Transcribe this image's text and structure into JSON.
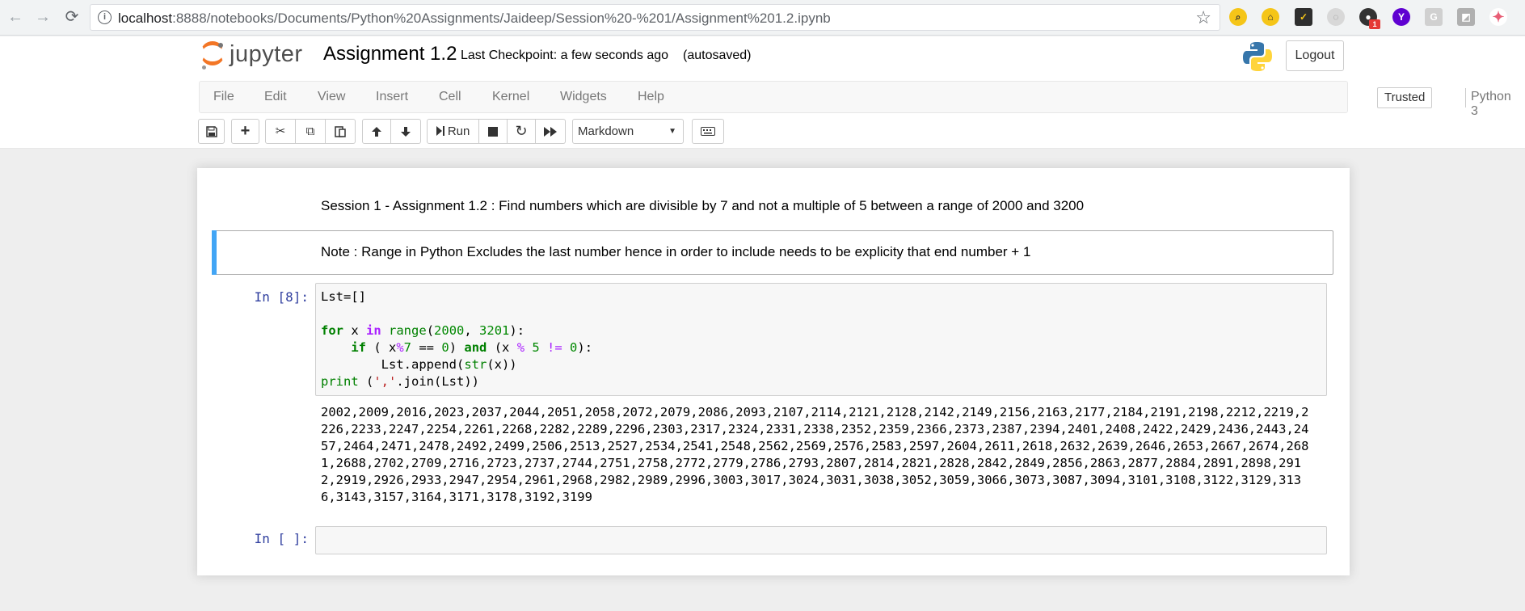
{
  "browser": {
    "url_host": "localhost",
    "url_rest": ":8888/notebooks/Documents/Python%20Assignments/Jaideep/Session%20-%201/Assignment%201.2.ipynb",
    "back_icon": "←",
    "forward_icon": "→",
    "reload_icon": "⟳",
    "info_icon": "i",
    "star_icon": "☆",
    "extensions": [
      {
        "icon": "search-extension-icon",
        "glyph": "⌕",
        "color": "#f5c518"
      },
      {
        "icon": "home-extension-icon",
        "glyph": "⌂",
        "color": "#f5c518"
      },
      {
        "icon": "checkmark-extension-icon",
        "glyph": "✓",
        "color": "#2e2e2e"
      },
      {
        "icon": "grey-circle-extension-icon",
        "glyph": "◌",
        "color": "#b0b0b0"
      },
      {
        "icon": "game-extension-icon",
        "glyph": "●",
        "color": "#333333",
        "badge": "1"
      },
      {
        "icon": "yahoo-extension-icon",
        "glyph": "Y",
        "color": "#5f01d1"
      },
      {
        "icon": "grey-g-extension-icon",
        "glyph": "G",
        "color": "#c0c0c0"
      },
      {
        "icon": "square-extension-icon",
        "glyph": "◩",
        "color": "#a0a0a0"
      },
      {
        "icon": "pinwheel-extension-icon",
        "glyph": "✦",
        "color": "#e85d75"
      }
    ]
  },
  "header": {
    "logo_text": "jupyter",
    "notebook_title": "Assignment 1.2",
    "checkpoint": "Last Checkpoint: a few seconds ago",
    "autosave": "(autosaved)",
    "logout_label": "Logout"
  },
  "menubar": {
    "items": [
      "File",
      "Edit",
      "View",
      "Insert",
      "Cell",
      "Kernel",
      "Widgets",
      "Help"
    ],
    "trusted_label": "Trusted",
    "kernel_name": "Python 3"
  },
  "toolbar": {
    "save_icon": "💾",
    "add_icon": "+",
    "cut_icon": "✂",
    "copy_icon": "⧉",
    "paste_icon": "📋",
    "move_up_icon": "🡅",
    "move_down_icon": "🡇",
    "run_icon": "⏭",
    "run_label": "Run",
    "stop_icon": "■",
    "restart_icon": "↻",
    "fast_forward_icon": "⏩",
    "cell_type": "Markdown",
    "keyboard_icon": "⌨"
  },
  "cells": {
    "markdown_1": "Session 1 - Assignment 1.2 : Find numbers which are divisible by 7 and not a multiple of 5 between a range of 2000 and 3200",
    "markdown_2": "Note : Range in Python Excludes the last number hence in order to include needs to be explicity that end number + 1",
    "code_prompt": "In [8]:",
    "code_lines": {
      "l1": "Lst=[]",
      "for_kw": "for",
      "x_var": " x ",
      "in_kw": "in",
      "range_fn": "range",
      "range_args_open": "(",
      "n2000": "2000",
      "comma": ", ",
      "n3201": "3201",
      "range_close": "):",
      "indent_if": "    ",
      "if_kw": "if",
      "if_open": " ( x",
      "mod": "%",
      "n7": "7",
      "eqeq": " == ",
      "n0a": "0",
      "close_and": ") ",
      "and_kw": "and",
      "x_mod": " (x ",
      "mod2": "%",
      "n5": " 5 ",
      "neq": "!=",
      "n0b": " 0",
      "if_close": "):",
      "append_line": "        Lst.append(",
      "str_fn": "str",
      "append_close": "(x))",
      "print_kw": "print",
      "print_open": " (",
      "sep_str": "','",
      "join_rest": ".join(Lst))"
    },
    "output": "2002,2009,2016,2023,2037,2044,2051,2058,2072,2079,2086,2093,2107,2114,2121,2128,2142,2149,2156,2163,2177,2184,2191,2198,2212,2219,2226,2233,2247,2254,2261,2268,2282,2289,2296,2303,2317,2324,2331,2338,2352,2359,2366,2373,2387,2394,2401,2408,2422,2429,2436,2443,2457,2464,2471,2478,2492,2499,2506,2513,2527,2534,2541,2548,2562,2569,2576,2583,2597,2604,2611,2618,2632,2639,2646,2653,2667,2674,2681,2688,2702,2709,2716,2723,2737,2744,2751,2758,2772,2779,2786,2793,2807,2814,2821,2828,2842,2849,2856,2863,2877,2884,2891,2898,2912,2919,2926,2933,2947,2954,2961,2968,2982,2989,2996,3003,3017,3024,3031,3038,3052,3059,3066,3073,3087,3094,3101,3108,3122,3129,3136,3143,3157,3164,3171,3178,3192,3199",
    "empty_prompt": "In [ ]:"
  },
  "colors": {
    "selection_bar": "#42a5f5",
    "prompt": "#303f9f",
    "jupyter_orange": "#f37626"
  }
}
